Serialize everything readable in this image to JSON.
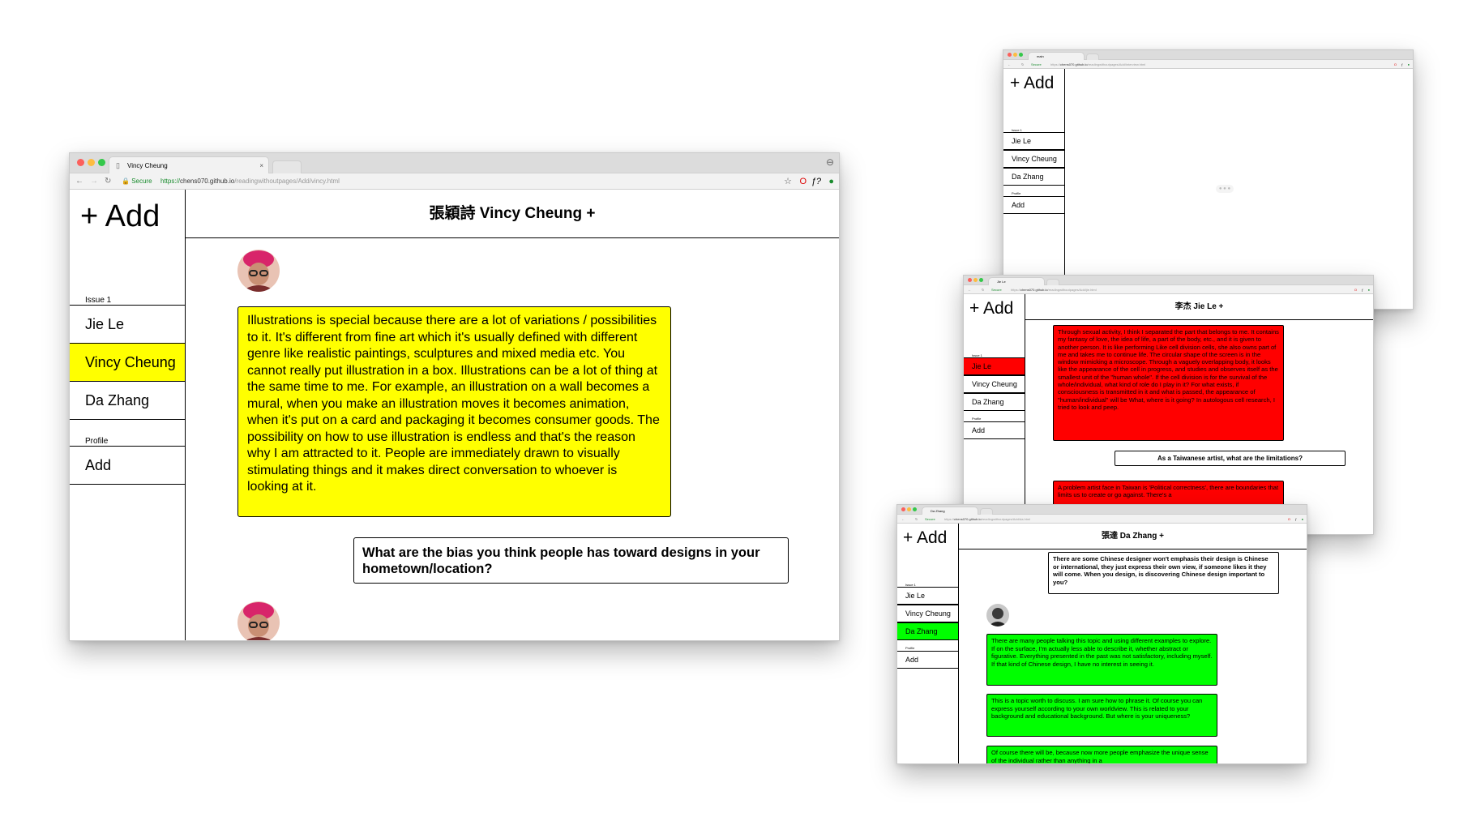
{
  "common": {
    "add_button": "+ Add",
    "issue_label": "Issue 1",
    "profile_label": "Profile",
    "profile_add": "Add",
    "people": [
      "Jie Le",
      "Vincy Cheung",
      "Da Zhang"
    ],
    "secure_label": "Secure",
    "url_scheme": "https://",
    "url_host": "chens070.github.io",
    "url_path_prefix": "/readingwithoutpages/Add/"
  },
  "colors": {
    "vincy": "#ffff00",
    "jie": "#ff0000",
    "da": "#00ff00"
  },
  "window_vincy": {
    "tab_title": "Vincy Cheung",
    "url_path_file": "vincy.html",
    "header": "張穎詩 Vincy Cheung +",
    "answer": "Illustrations is special because there are a lot of variations / possibilities to it. It's different from fine art which it's usually defined with different genre like realistic paintings, sculptures and mixed media etc. You cannot really put illustration in a box. Illustrations can be a lot of thing at the same time to me. For example, an illustration on a wall becomes a mural, when you make an illustration moves it becomes animation, when it's put on a card and packaging it becomes consumer goods. The possibility on how to use illustration is endless and that's the reason why I am attracted to it. People are immediately drawn to visually stimulating things and it makes direct conversation to whoever is looking at it.",
    "question": "What are the bias you think people has toward designs in your hometown/location?"
  },
  "window_main": {
    "tab_title": "main",
    "url_path_file": "interview.html"
  },
  "window_jie": {
    "tab_title": "Jie Le",
    "url_path_file": "jie.html",
    "header": "李杰 Jie Le +",
    "answer": "Through sexual activity, I think I separated the part that belongs to me. It contains my fantasy of love, the idea of life, a part of the body, etc., and it is given to another person. It is like performing Like cell division cells, she also owns part of me and takes me to continue life. The circular shape of the screen is in the window mimicking a microscope. Through a vaguely overlapping body, it looks like the appearance of the cell in progress, and studies and observes itself as the smallest unit of the \"human whole\". If the cell division is for the survival of the whole/individual, what kind of role do I play in it? For what exists, if consciousness is transmitted in it and what is passed, the appearance of \"human/individual\" will be What, where is it going? In autologous cell research, I tried to look and peep.",
    "question": "As a Taiwanese artist, what are the limitations?",
    "answer2": "A problem artist face in Taiwan is 'Political correctness', there are boundaries that limits us to create or go against. There's a"
  },
  "window_da": {
    "tab_title": "Da Zhang",
    "url_path_file": "da.html",
    "header": "張達 Da Zhang +",
    "question": "There are some Chinese designer won't emphasis their design is Chinese or international, they just express their own view, if someone likes it they will come. When you design, is discovering Chinese design important to you?",
    "answer1": "There are many people talking this topic and using different examples to explore. If on the surface, I'm actually less able to describe it, whether abstract or figurative. Everything presented in the past was not satisfactory, including myself. If that kind of Chinese design, I have no interest in seeing it.",
    "answer2": "This is a topic worth to discuss. I am sure how to phrase it. Of course you can express yourself according to your own worldview. This is related to your background and educational background. But where is your uniqueness?",
    "answer3": "Of course there will be, because now more people emphasize the unique sense of the individual rather than anything in a"
  }
}
